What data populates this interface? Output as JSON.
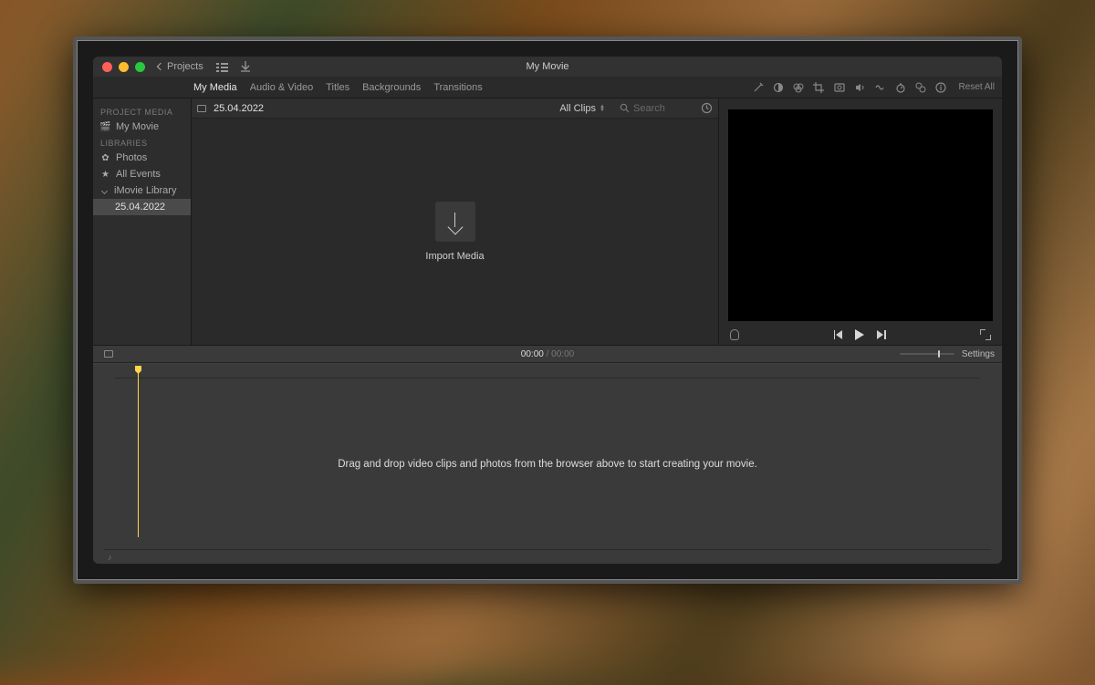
{
  "titlebar": {
    "back_label": "Projects",
    "title": "My Movie"
  },
  "tabs": {
    "my_media": "My Media",
    "audio_video": "Audio & Video",
    "titles": "Titles",
    "backgrounds": "Backgrounds",
    "transitions": "Transitions",
    "reset_all": "Reset All"
  },
  "sidebar": {
    "project_media_header": "PROJECT MEDIA",
    "project_name": "My Movie",
    "libraries_header": "LIBRARIES",
    "photos": "Photos",
    "all_events": "All Events",
    "imovie_library": "iMovie Library",
    "event_1": "25.04.2022"
  },
  "browser": {
    "event_title": "25.04.2022",
    "clips_selector": "All Clips",
    "search_placeholder": "Search",
    "import_label": "Import Media"
  },
  "timeline": {
    "current": "00:00",
    "duration": "00:00",
    "settings": "Settings",
    "empty_msg": "Drag and drop video clips and photos from the browser above to start creating your movie."
  }
}
